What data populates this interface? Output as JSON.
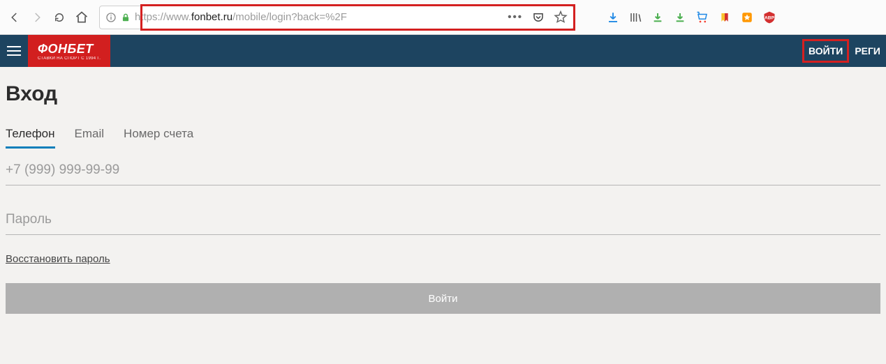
{
  "browser": {
    "url_prefix": "https://www.",
    "url_host": "fonbet.ru",
    "url_path": "/mobile/login?back=%2F"
  },
  "header": {
    "logo_main": "ФОНБЕТ",
    "logo_sub": "СТАВКИ НА СПОРТ С 1994 Г.",
    "login": "ВОЙТИ",
    "register": "РЕГИ"
  },
  "page": {
    "title": "Вход",
    "tabs": {
      "phone": "Телефон",
      "email": "Email",
      "account": "Номер счета"
    },
    "phone_placeholder": "+7 (999) 999-99-99",
    "password_placeholder": "Пароль",
    "recover": "Восстановить пароль",
    "submit": "Войти"
  }
}
